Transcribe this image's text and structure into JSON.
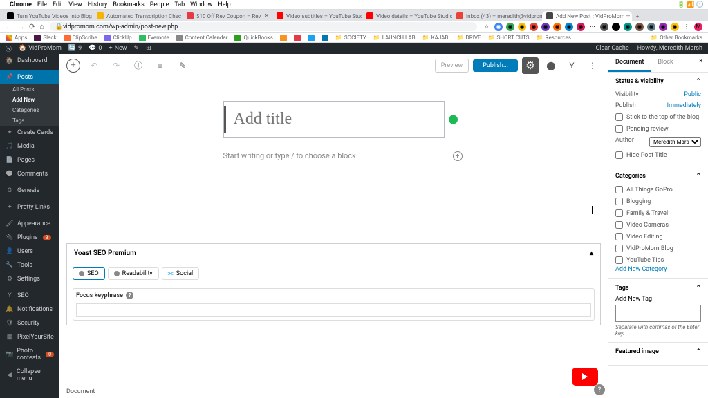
{
  "menubar": {
    "app": "Chrome",
    "items": [
      "File",
      "Edit",
      "View",
      "History",
      "Bookmarks",
      "People",
      "Tab",
      "Window",
      "Help"
    ]
  },
  "tabs": [
    {
      "label": "Turn YouTube Videos into Blog"
    },
    {
      "label": "Automated Transcription Chec"
    },
    {
      "label": "$10 Off Rev Coupon – Rev"
    },
    {
      "label": "Video subtitles – YouTube Studio"
    },
    {
      "label": "Video details – YouTube Studio"
    },
    {
      "label": "Inbox (43) – meredith@vidprom"
    },
    {
      "label": "Add New Post ‹ VidProMom —",
      "active": true
    }
  ],
  "url": "vidpromom.com/wp-admin/post-new.php",
  "bookmarks": [
    "Apps",
    "Slack",
    "ClipScribe",
    "ClickUp",
    "Evernote",
    "Content Calendar",
    "QuickBooks",
    "",
    "",
    "",
    "",
    "SOCIETY",
    "LAUNCH LAB",
    "KAJABI",
    "DRIVE",
    "SHORT CUTS",
    "Resources"
  ],
  "otherbm": "Other Bookmarks",
  "wpbar": {
    "site": "VidProMom",
    "updates": "9",
    "comments": "0",
    "new": "New",
    "clear": "Clear Cache",
    "howdy": "Howdy, Meredith Marsh"
  },
  "sidebar": {
    "dash": "Dashboard",
    "posts": "Posts",
    "allposts": "All Posts",
    "addnew": "Add New",
    "cats": "Categories",
    "tags": "Tags",
    "cards": "Create Cards",
    "media": "Media",
    "pages": "Pages",
    "comments": "Comments",
    "genesis": "Genesis",
    "pretty": "Pretty Links",
    "appear": "Appearance",
    "plugins": "Plugins",
    "pluginsN": "3",
    "users": "Users",
    "tools": "Tools",
    "settings": "Settings",
    "seo": "SEO",
    "notif": "Notifications",
    "security": "Security",
    "pixel": "PixelYourSite",
    "photo": "Photo contests",
    "photoN": "0",
    "collapse": "Collapse menu"
  },
  "topbar": {
    "preview": "Preview",
    "publish": "Publish..."
  },
  "title_placeholder": "Add title",
  "para_placeholder": "Start writing or type / to choose a block",
  "yoast": {
    "title": "Yoast SEO Premium",
    "seo": "SEO",
    "read": "Readability",
    "social": "Social",
    "kp": "Focus keyphrase"
  },
  "footer": "Document",
  "panel": {
    "doc": "Document",
    "block": "Block",
    "status": "Status & visibility",
    "vis": "Visibility",
    "visval": "Public",
    "pub": "Publish",
    "pubval": "Immediately",
    "stick": "Stick to the top of the blog",
    "pending": "Pending review",
    "author": "Author",
    "authorval": "Meredith Marsh",
    "hide": "Hide Post Title",
    "catshead": "Categories",
    "cats": [
      "All Things GoPro",
      "Blogging",
      "Family & Travel",
      "Video Cameras",
      "Video Editing",
      "VidProMom Blog",
      "YouTube Tips"
    ],
    "addcat": "Add New Category",
    "tagshead": "Tags",
    "addtag": "Add New Tag",
    "taghint": "Separate with commas or the Enter key.",
    "featured": "Featured image"
  }
}
